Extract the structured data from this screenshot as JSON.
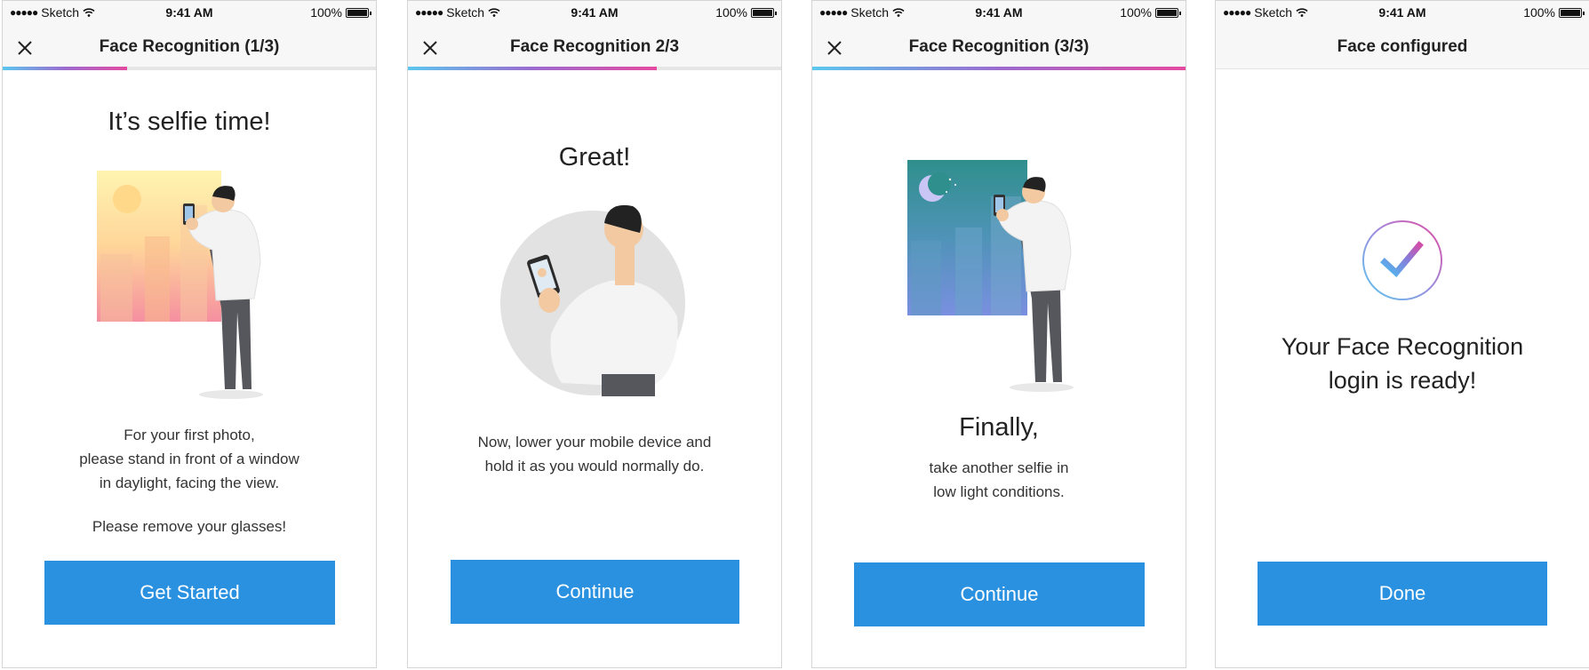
{
  "status": {
    "carrier": "Sketch",
    "time": "9:41 AM",
    "battery": "100%"
  },
  "screens": [
    {
      "title": "Face Recognition (1/3)",
      "progress": 0.333,
      "heading": "It’s selfie time!",
      "lines": [
        "For your first photo,",
        "please stand in front of a window",
        "in daylight, facing the view."
      ],
      "note": "Please remove your glasses!",
      "button": "Get Started"
    },
    {
      "title": "Face Recognition 2/3",
      "progress": 0.667,
      "heading": "Great!",
      "lines": [
        "Now, lower your mobile device and",
        "hold it as you would normally do."
      ],
      "button": "Continue"
    },
    {
      "title": "Face Recognition (3/3)",
      "progress": 1.0,
      "heading": "Finally,",
      "lines": [
        "take another selfie in",
        "low light conditions."
      ],
      "button": "Continue"
    },
    {
      "title": "Face configured",
      "lines": [
        "Your Face Recognition",
        "login is ready!"
      ],
      "button": "Done"
    }
  ],
  "colors": {
    "primary": "#2a91e1",
    "gradient_start": "#5bc7ee",
    "gradient_end": "#e54aa0"
  }
}
